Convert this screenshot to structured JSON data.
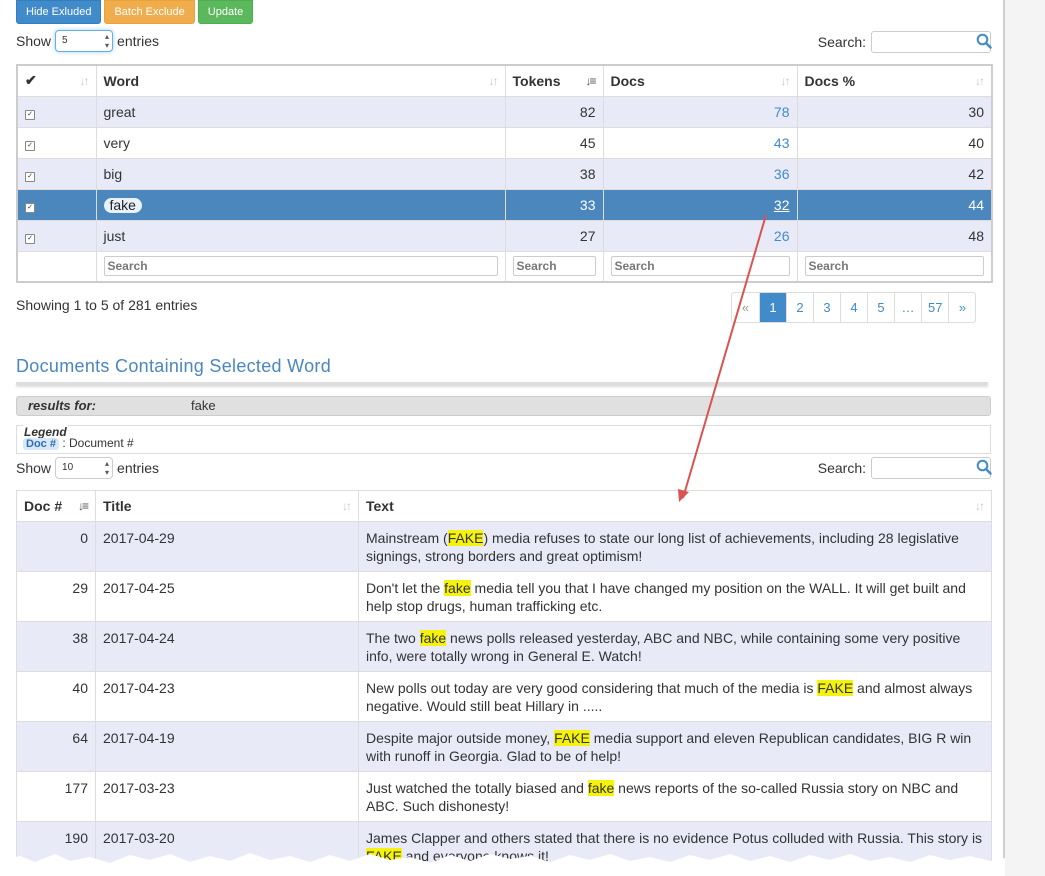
{
  "toolbar": {
    "hide_excluded": "Hide Exluded",
    "batch_exclude": "Batch Exclude",
    "update": "Update"
  },
  "words_table": {
    "show_label": "Show",
    "entries_label": "entries",
    "page_length": "5",
    "search_label": "Search:",
    "columns": {
      "check": "✔",
      "word": "Word",
      "tokens": "Tokens",
      "docs": "Docs",
      "docs_pct": "Docs %"
    },
    "rows": [
      {
        "word": "great",
        "tokens": "82",
        "docs": "78",
        "docs_pct": "30"
      },
      {
        "word": "very",
        "tokens": "45",
        "docs": "43",
        "docs_pct": "40"
      },
      {
        "word": "big",
        "tokens": "38",
        "docs": "36",
        "docs_pct": "42"
      },
      {
        "word": "fake",
        "tokens": "33",
        "docs": "32",
        "docs_pct": "44"
      },
      {
        "word": "just",
        "tokens": "27",
        "docs": "26",
        "docs_pct": "48"
      }
    ],
    "column_search_placeholder": "Search",
    "info": "Showing 1 to 5 of 281 entries",
    "pagination": [
      "«",
      "1",
      "2",
      "3",
      "4",
      "5",
      "…",
      "57",
      "»"
    ]
  },
  "documents": {
    "title": "Documents Containing Selected Word",
    "results_label": "results for:",
    "results_value": "fake",
    "legend_title": "Legend",
    "legend_badge": "Doc #",
    "legend_text": ": Document #",
    "show_label": "Show",
    "entries_label": "entries",
    "page_length": "10",
    "search_label": "Search:",
    "columns": {
      "doc": "Doc #",
      "title": "Title",
      "text": "Text"
    },
    "rows": [
      {
        "doc": "0",
        "title": "2017-04-29",
        "pre": "Mainstream (",
        "hl": "FAKE",
        "post": ") media refuses to state our long list of achievements, including 28 legislative signings, strong borders and great optimism!"
      },
      {
        "doc": "29",
        "title": "2017-04-25",
        "pre": "Don't let the ",
        "hl": "fake",
        "post": " media tell you that I have changed my position on the WALL. It will get built and help stop drugs, human trafficking etc."
      },
      {
        "doc": "38",
        "title": "2017-04-24",
        "pre": "The two ",
        "hl": "fake",
        "post": " news polls released yesterday, ABC and NBC, while containing some very positive info, were totally wrong in General E. Watch!"
      },
      {
        "doc": "40",
        "title": "2017-04-23",
        "pre": "New polls out today are very good considering that much of the media is ",
        "hl": "FAKE",
        "post": " and almost always negative. Would still beat Hillary in ....."
      },
      {
        "doc": "64",
        "title": "2017-04-19",
        "pre": "Despite major outside money, ",
        "hl": "FAKE",
        "post": " media support and eleven Republican candidates, BIG R win with runoff in Georgia. Glad to be of help!"
      },
      {
        "doc": "177",
        "title": "2017-03-23",
        "pre": "Just watched the totally biased and ",
        "hl": "fake",
        "post": " news reports of the so-called Russia story on NBC and ABC. Such dishonesty!"
      },
      {
        "doc": "190",
        "title": "2017-03-20",
        "pre": "James Clapper and others stated that there is no evidence Potus colluded with Russia. This story is ",
        "hl": "FAKE",
        "post": " and everyone knows it!"
      }
    ]
  },
  "colors": {
    "accent": "#428bca",
    "selected_row": "#4b86bd",
    "row_stripe": "#e8eaf8",
    "highlight": "#f5f20e",
    "annotation_arrow": "#d9534f"
  }
}
